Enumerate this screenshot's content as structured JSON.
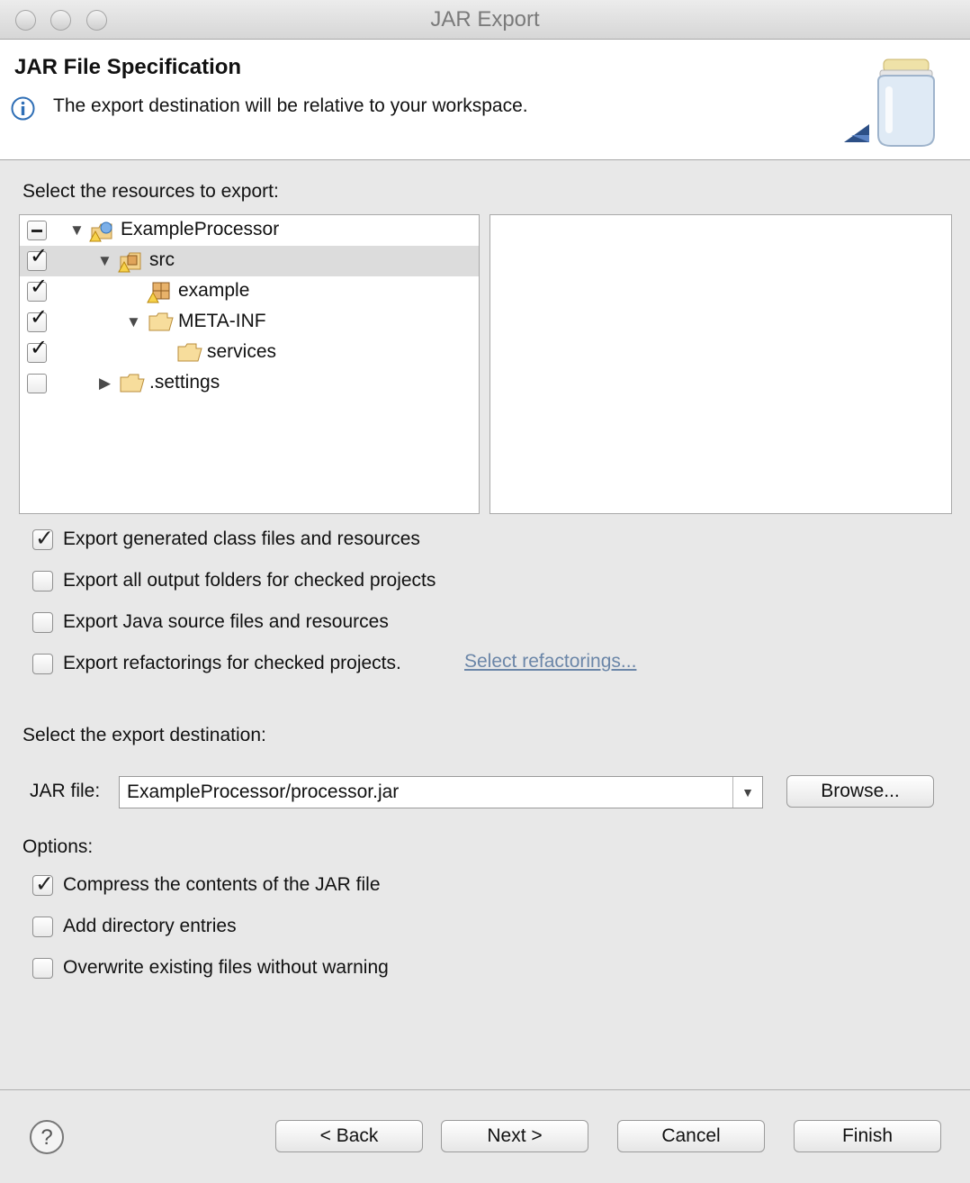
{
  "window": {
    "title": "JAR Export"
  },
  "header": {
    "title": "JAR File Specification",
    "message": "The export destination will be relative to your workspace."
  },
  "resources": {
    "label": "Select the resources to export:",
    "tree": [
      {
        "label": "ExampleProcessor",
        "check": "partial",
        "expanded": true,
        "icon": "java-project-icon"
      },
      {
        "label": "src",
        "check": "checked",
        "expanded": true,
        "icon": "source-folder-icon",
        "selected": true
      },
      {
        "label": "example",
        "check": "checked",
        "icon": "package-icon"
      },
      {
        "label": "META-INF",
        "check": "checked",
        "expanded": true,
        "icon": "folder-icon"
      },
      {
        "label": "services",
        "check": "checked",
        "icon": "folder-icon"
      },
      {
        "label": ".settings",
        "check": "unchecked",
        "expanded": false,
        "icon": "folder-icon"
      }
    ]
  },
  "export_options": [
    {
      "label": "Export generated class files and resources",
      "checked": true
    },
    {
      "label": "Export all output folders for checked projects",
      "checked": false
    },
    {
      "label": "Export Java source files and resources",
      "checked": false
    },
    {
      "label": "Export refactorings for checked projects.",
      "checked": false
    }
  ],
  "select_refactorings_link": "Select refactorings...",
  "destination": {
    "label": "Select the export destination:",
    "jar_label": "JAR file:",
    "jar_value": "ExampleProcessor/processor.jar",
    "browse_label": "Browse..."
  },
  "options": {
    "label": "Options:",
    "items": [
      {
        "label": "Compress the contents of the JAR file",
        "checked": true
      },
      {
        "label": "Add directory entries",
        "checked": false
      },
      {
        "label": "Overwrite existing files without warning",
        "checked": false
      }
    ]
  },
  "footer": {
    "back": "< Back",
    "next": "Next >",
    "cancel": "Cancel",
    "finish": "Finish"
  }
}
